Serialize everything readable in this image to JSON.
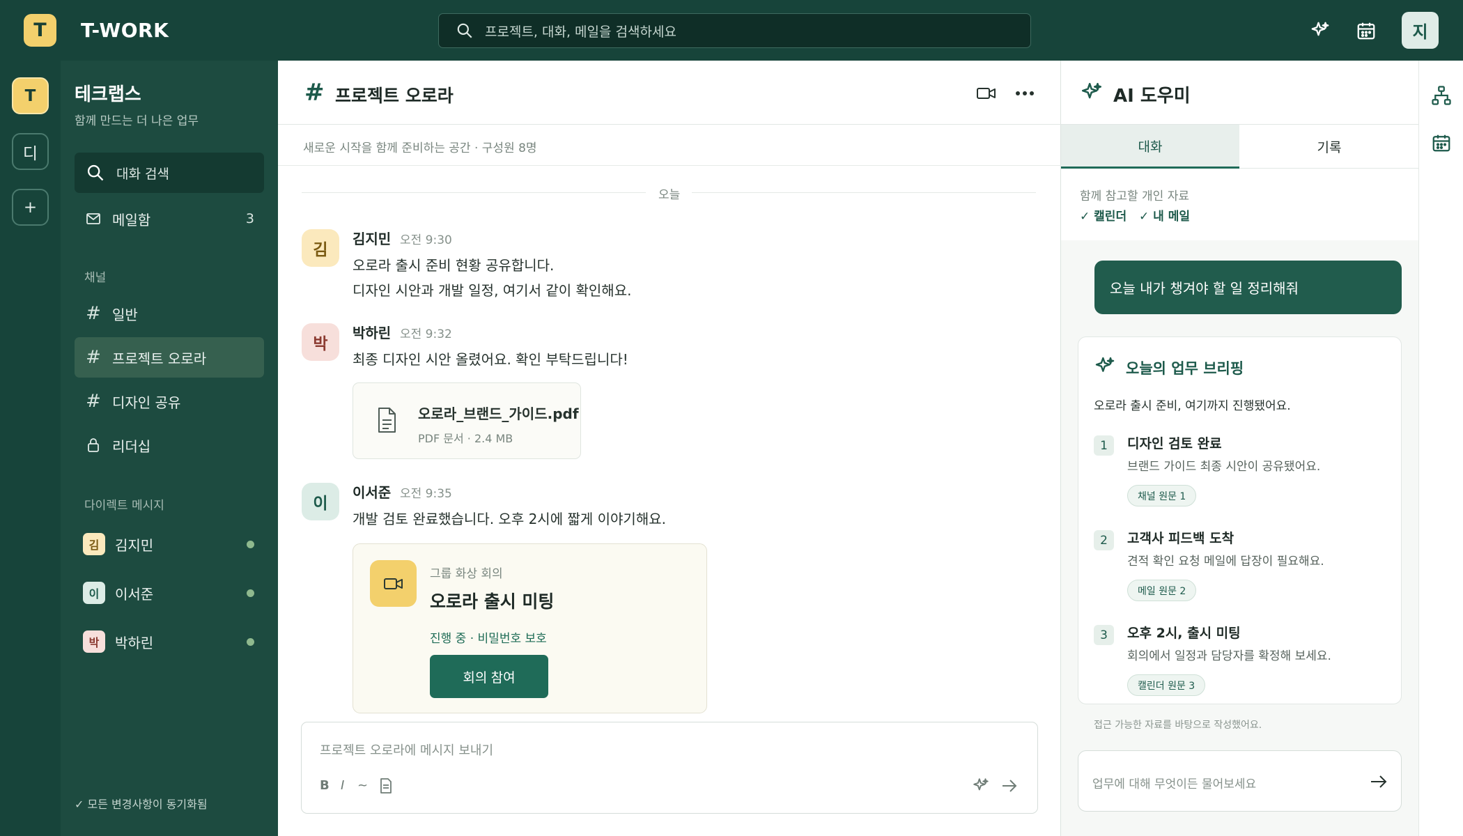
{
  "colors": {
    "brand_dark": "#17443a",
    "sidebar": "#1d4b40",
    "accent": "#1f6b58",
    "yellow": "#f3d06c"
  },
  "app": {
    "logo_letter": "T",
    "title": "T-WORK",
    "search_placeholder": "프로젝트, 대화, 메일을 검색하세요",
    "user_initial": "지"
  },
  "rail": {
    "items": [
      {
        "label": "T"
      },
      {
        "label": "디"
      },
      {
        "label": "+"
      }
    ]
  },
  "sidebar": {
    "workspace_name": "테크랩스",
    "workspace_tagline": "함께 만드는 더 나은 업무",
    "search_label": "대화 검색",
    "inbox": {
      "label": "메일함",
      "count": "3"
    },
    "channels_heading": "채널",
    "channels": [
      {
        "label": "일반",
        "icon": "hash-icon"
      },
      {
        "label": "프로젝트 오로라",
        "icon": "hash-icon",
        "active": true
      },
      {
        "label": "디자인 공유",
        "icon": "hash-icon"
      },
      {
        "label": "리더십",
        "icon": "lock-icon"
      }
    ],
    "dm_heading": "다이렉트 메시지",
    "dms": [
      {
        "initial": "김",
        "name": "김지민"
      },
      {
        "initial": "이",
        "name": "이서준"
      },
      {
        "initial": "박",
        "name": "박하린"
      }
    ],
    "sync_status": "✓ 모든 변경사항이 동기화됨"
  },
  "channel": {
    "hash": "#",
    "title": "프로젝트 오로라",
    "subtitle": "새로운 시작을 함께 준비하는 공간 · 구성원 8명",
    "day_divider": "오늘",
    "messages": [
      {
        "initial": "김",
        "name": "김지민",
        "time": "오전 9:30",
        "lines": [
          "오로라 출시 준비 현황 공유합니다.",
          "디자인 시안과 개발 일정, 여기서 같이 확인해요."
        ]
      },
      {
        "initial": "박",
        "name": "박하린",
        "time": "오전 9:32",
        "lines": [
          "최종 디자인 시안 올렸어요. 확인 부탁드립니다!"
        ]
      },
      {
        "initial": "이",
        "name": "이서준",
        "time": "오전 9:35",
        "lines": [
          "개발 검토 완료했습니다. 오후 2시에 짧게 이야기해요."
        ]
      }
    ],
    "attachment": {
      "name": "오로라_브랜드_가이드.pdf",
      "meta": "PDF 문서 · 2.4 MB"
    },
    "meeting": {
      "kind": "그룹 화상 회의",
      "title": "오로라 출시 미팅",
      "status": "진행 중 · 비밀번호 보호",
      "join_label": "회의 참여"
    },
    "composer": {
      "placeholder": "프로젝트 오로라에 메시지 보내기",
      "bold": "B",
      "italic": "I",
      "strike": "~"
    }
  },
  "assistant": {
    "title": "AI 도우미",
    "tabs": [
      {
        "label": "대화",
        "active": true
      },
      {
        "label": "기록"
      }
    ],
    "context_label": "함께 참고할 개인 자료",
    "context_sources": [
      "✓ 캘린더",
      "✓ 내 메일"
    ],
    "user_prompt": "오늘 내가 챙겨야 할 일 정리해줘",
    "briefing": {
      "title": "오늘의 업무 브리핑",
      "intro": "오로라 출시 준비, 여기까지 진행됐어요.",
      "items": [
        {
          "num": "1",
          "title": "디자인 검토 완료",
          "desc": "브랜드 가이드 최종 시안이 공유됐어요.",
          "source": "채널 원문 1"
        },
        {
          "num": "2",
          "title": "고객사 피드백 도착",
          "desc": "견적 확인 요청 메일에 답장이 필요해요.",
          "source": "메일 원문 2"
        },
        {
          "num": "3",
          "title": "오후 2시, 출시 미팅",
          "desc": "회의에서 일정과 담당자를 확정해 보세요.",
          "source": "캘린더 원문 3"
        }
      ],
      "footnote": "접근 가능한 자료를 바탕으로 작성했어요."
    },
    "input_placeholder": "업무에 대해 무엇이든 물어보세요"
  }
}
